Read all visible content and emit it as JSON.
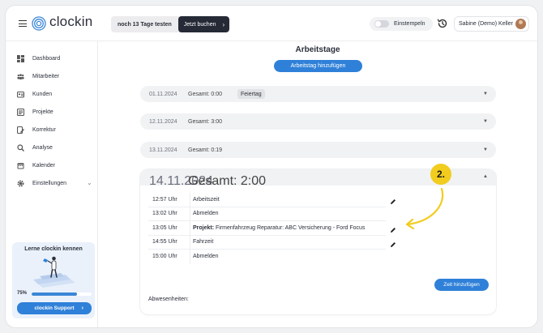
{
  "app": {
    "name": "clockin"
  },
  "topbar": {
    "trial_text": "noch 13 Tage testen",
    "buy_label": "Jetzt buchen",
    "clockin_label": "Einstempeln",
    "user_name": "Sabine (Demo) Keller"
  },
  "sidebar": {
    "items": [
      {
        "label": "Dashboard",
        "icon": "dashboard-icon"
      },
      {
        "label": "Mitarbeiter",
        "icon": "users-icon"
      },
      {
        "label": "Kunden",
        "icon": "customers-icon"
      },
      {
        "label": "Projekte",
        "icon": "projects-icon"
      },
      {
        "label": "Korrektur",
        "icon": "correction-icon"
      },
      {
        "label": "Analyse",
        "icon": "analysis-icon"
      },
      {
        "label": "Kalender",
        "icon": "calendar-icon"
      },
      {
        "label": "Einstellungen",
        "icon": "gear-icon"
      }
    ],
    "learn_card": {
      "title": "Lerne clockin kennen",
      "progress_label": "75%",
      "progress_value": 75,
      "support_label": "clockin Support"
    }
  },
  "main": {
    "title": "Arbeitstage",
    "add_day_label": "Arbeitstag hinzufügen",
    "days": [
      {
        "date": "01.11.2024",
        "total": "Gesamt: 0:00",
        "badge": "Feiertag"
      },
      {
        "date": "12.11.2024",
        "total": "Gesamt: 3:00"
      },
      {
        "date": "13.11.2024",
        "total": "Gesamt: 0:19"
      },
      {
        "date": "14.11.2024",
        "total": "Gesamt: 2:00"
      }
    ],
    "entries": [
      {
        "time": "12:57 Uhr",
        "label": "Arbeitszeit",
        "editable": true
      },
      {
        "time": "13:02 Uhr",
        "label": "Abmelden",
        "editable": false
      },
      {
        "time": "13:05 Uhr",
        "label_bold": "Projekt:",
        "label": "Firmenfahrzeug Reparatur: ABC Versicherung - Ford Focus",
        "editable": true
      },
      {
        "time": "14:55 Uhr",
        "label": "Fahrzeit",
        "editable": true
      },
      {
        "time": "15:00 Uhr",
        "label": "Abmelden",
        "editable": false
      }
    ],
    "add_time_label": "Zeit hinzufügen",
    "absences_label": "Abwesenheiten:"
  },
  "annotation": {
    "step_label": "2.",
    "color": "#f2cc1e"
  },
  "colors": {
    "accent": "#2f80d8",
    "dark": "#252a36",
    "highlight": "#f2cc1e"
  }
}
